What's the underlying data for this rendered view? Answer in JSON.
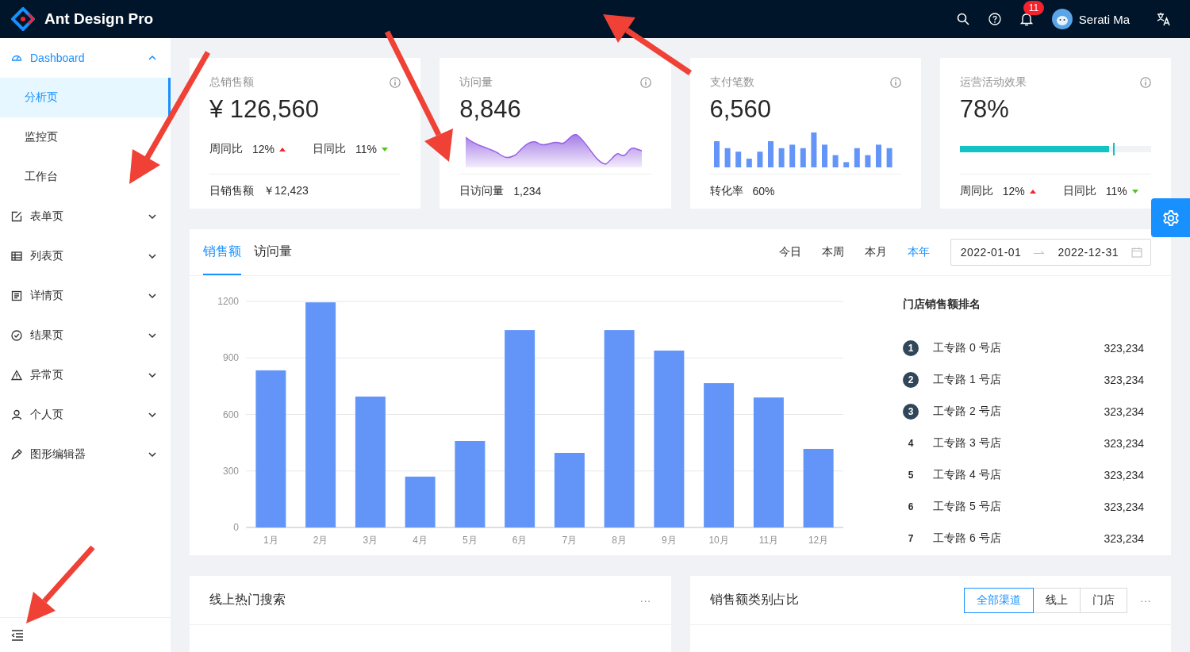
{
  "header": {
    "title": "Ant Design Pro",
    "notification_count": "11",
    "user_name": "Serati Ma"
  },
  "sidebar": {
    "items": [
      {
        "label": "Dashboard",
        "expanded": true,
        "children": [
          {
            "label": "分析页",
            "selected": true
          },
          {
            "label": "监控页",
            "selected": false
          },
          {
            "label": "工作台",
            "selected": false
          }
        ]
      },
      {
        "label": "表单页",
        "expanded": false
      },
      {
        "label": "列表页",
        "expanded": false
      },
      {
        "label": "详情页",
        "expanded": false
      },
      {
        "label": "结果页",
        "expanded": false
      },
      {
        "label": "异常页",
        "expanded": false
      },
      {
        "label": "个人页",
        "expanded": false
      },
      {
        "label": "图形编辑器",
        "expanded": false
      }
    ]
  },
  "stat_cards": [
    {
      "kind": "trend",
      "title": "总销售额",
      "value": "¥ 126,560",
      "trends": [
        {
          "label": "周同比",
          "value": "12%",
          "up": true
        },
        {
          "label": "日同比",
          "value": "11%",
          "up": false
        }
      ],
      "footer": {
        "label": "日销售额",
        "value": "￥12,423"
      }
    },
    {
      "kind": "area",
      "title": "访问量",
      "value": "8,846",
      "footer": {
        "label": "日访问量",
        "value": "1,234"
      }
    },
    {
      "kind": "bar",
      "title": "支付笔数",
      "value": "6,560",
      "footer": {
        "label": "转化率",
        "value": "60%"
      }
    },
    {
      "kind": "progress",
      "title": "运营活动效果",
      "value": "78%",
      "level": 0.78,
      "footer_trends": [
        {
          "label": "周同比",
          "value": "12%",
          "up": true
        },
        {
          "label": "日同比",
          "value": "11%",
          "up": false
        }
      ]
    }
  ],
  "sales_card": {
    "tabs": [
      {
        "label": "销售额",
        "selected": true
      },
      {
        "label": "访问量",
        "selected": false
      }
    ],
    "ranges": [
      {
        "label": "今日",
        "selected": false
      },
      {
        "label": "本周",
        "selected": false
      },
      {
        "label": "本月",
        "selected": false
      },
      {
        "label": "本年",
        "selected": true
      }
    ],
    "date_start": "2022-01-01",
    "date_end": "2022-12-31",
    "chart_data": {
      "type": "bar",
      "categories": [
        "1月",
        "2月",
        "3月",
        "4月",
        "5月",
        "6月",
        "7月",
        "8月",
        "9月",
        "10月",
        "11月",
        "12月"
      ],
      "series": [
        {
          "color": "#6395f9",
          "values": [
            834,
            1195,
            695,
            270,
            459,
            1048,
            396,
            1048,
            939,
            766,
            690,
            417
          ]
        }
      ],
      "grid": true,
      "ylim": [
        0,
        1200
      ],
      "yticks": [
        0,
        300,
        600,
        900,
        1200
      ]
    },
    "ranking_title": "门店销售额排名",
    "ranking": [
      {
        "rank": "1",
        "name": "工专路 0 号店",
        "value": "323,234",
        "highlighted": true
      },
      {
        "rank": "2",
        "name": "工专路 1 号店",
        "value": "323,234",
        "highlighted": true
      },
      {
        "rank": "3",
        "name": "工专路 2 号店",
        "value": "323,234",
        "highlighted": true
      },
      {
        "rank": "4",
        "name": "工专路 3 号店",
        "value": "323,234",
        "highlighted": false
      },
      {
        "rank": "5",
        "name": "工专路 4 号店",
        "value": "323,234",
        "highlighted": false
      },
      {
        "rank": "6",
        "name": "工专路 5 号店",
        "value": "323,234",
        "highlighted": false
      },
      {
        "rank": "7",
        "name": "工专路 6 号店",
        "value": "323,234",
        "highlighted": false
      }
    ]
  },
  "bottom_cards": [
    {
      "title": "线上热门搜索",
      "more": "···"
    },
    {
      "title": "销售额类别占比",
      "options": [
        {
          "label": "全部渠道",
          "selected": true
        },
        {
          "label": "线上",
          "selected": false
        },
        {
          "label": "门店",
          "selected": false
        }
      ],
      "more": "···"
    }
  ]
}
